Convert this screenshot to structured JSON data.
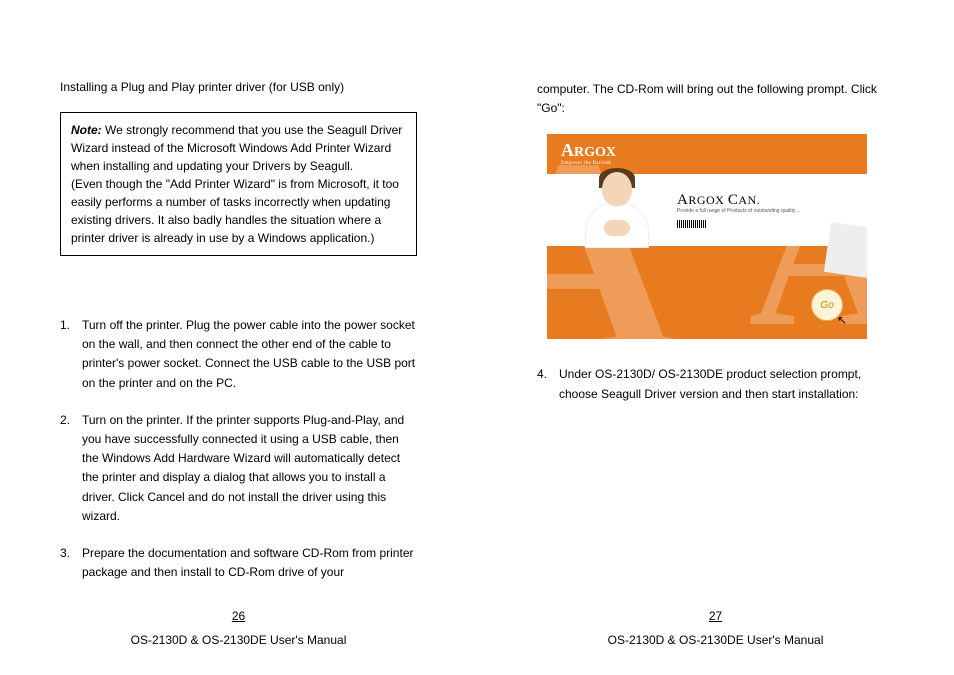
{
  "left": {
    "title": "Installing a Plug and Play printer driver (for USB only)",
    "note_label": "Note:",
    "note_body": "We strongly recommend that you use the Seagull Driver Wizard instead of the Microsoft Windows Add Printer Wizard when installing and updating your Drivers by Seagull.\n(Even though the \"Add Printer Wizard\" is from Microsoft, it too easily performs a number of tasks incorrectly when updating existing drivers. It also badly handles the situation where a printer driver is already in use by a Windows application.)",
    "steps": [
      "Turn off the printer. Plug the power cable into the power socket on the wall, and then connect the other end of the cable to printer's power socket. Connect the USB cable to the USB port on the printer and on the PC.",
      "Turn on the printer. If the printer supports Plug-and-Play, and you have successfully connected it using a USB cable, then the Windows Add Hardware Wizard will automatically detect the printer and display a dialog that allows you to install a driver. Click Cancel and do not install the driver using this wizard.",
      "Prepare the documentation and software CD-Rom from printer package and then install to CD-Rom drive of your"
    ],
    "page_number": "26",
    "footer": "OS-2130D & OS-2130DE User's Manual"
  },
  "right": {
    "continuation": "computer. The CD-Rom will bring out the following prompt. Click \"Go\":",
    "splash": {
      "brand_big": "A",
      "brand_rest": "RGOX",
      "brand_tag": "Empower the Barcode",
      "headline_1": "A",
      "headline_2": "RGOX ",
      "headline_3": "C",
      "headline_4": "AN.",
      "subline": "Provide a full range of Products of outstanding quality…",
      "go_label": "Go"
    },
    "step4_num": "4.",
    "step4_text": "Under OS-2130D/ OS-2130DE product selection prompt, choose Seagull Driver version and then start installation:",
    "page_number": "27",
    "footer": "OS-2130D & OS-2130DE User's Manual"
  }
}
